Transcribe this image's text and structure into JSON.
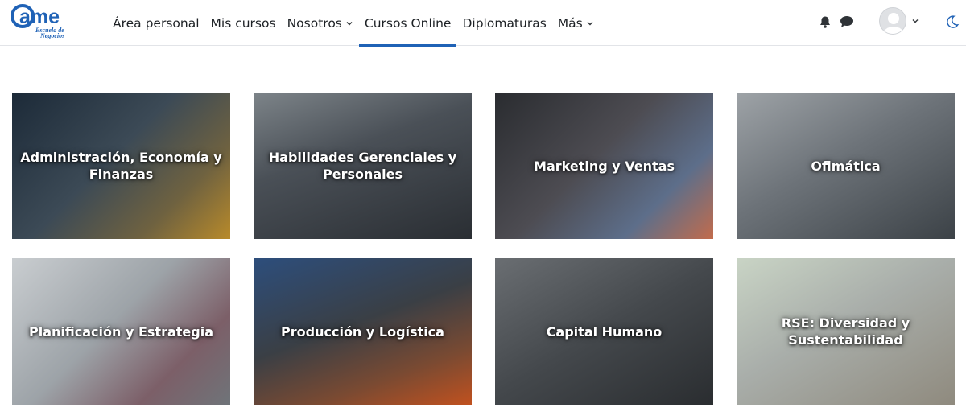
{
  "brand": {
    "logo_text": "ame",
    "logo_subtitle_1": "Escuela de",
    "logo_subtitle_2": "Negocios",
    "accent_color": "#1f62b6"
  },
  "nav": {
    "items": [
      {
        "label": "Área personal",
        "has_caret": false,
        "active": false
      },
      {
        "label": "Mis cursos",
        "has_caret": false,
        "active": false
      },
      {
        "label": "Nosotros",
        "has_caret": true,
        "active": false
      },
      {
        "label": "Cursos Online",
        "has_caret": false,
        "active": true
      },
      {
        "label": "Diplomaturas",
        "has_caret": false,
        "active": false
      },
      {
        "label": "Más",
        "has_caret": true,
        "active": false
      }
    ],
    "icons": [
      "bell-icon",
      "chat-icon",
      "avatar",
      "chevron-down-icon",
      "moon-icon"
    ]
  },
  "categories": [
    {
      "label": "Administración, Economía y Finanzas"
    },
    {
      "label": "Habilidades Gerenciales y Personales"
    },
    {
      "label": "Marketing y Ventas"
    },
    {
      "label": "Ofimática"
    },
    {
      "label": "Planificación y Estrategia"
    },
    {
      "label": "Producción y Logística"
    },
    {
      "label": "Capital Humano"
    },
    {
      "label": "RSE: Diversidad y Sustentabilidad"
    }
  ]
}
